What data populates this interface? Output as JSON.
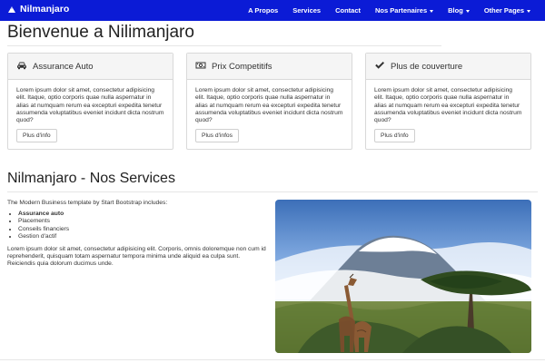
{
  "navbar": {
    "brand": "Nilmanjaro",
    "items": [
      {
        "label": "A Propos"
      },
      {
        "label": "Services"
      },
      {
        "label": "Contact"
      },
      {
        "label": "Nos Partenaires"
      },
      {
        "label": "Blog"
      },
      {
        "label": "Other Pages"
      }
    ]
  },
  "page": {
    "title": "Bienvenue a Nilimanjaro"
  },
  "panels": [
    {
      "title": "Assurance Auto",
      "icon": "car-icon",
      "text": "Lorem ipsum dolor sit amet, consectetur adipisicing elit. Itaque, optio corporis quae nulla aspernatur in alias at numquam rerum ea excepturi expedita tenetur assumenda voluptatibus eveniet incidunt dicta nostrum quod?",
      "button": "Plus d'info"
    },
    {
      "title": "Prix Competitifs",
      "icon": "money-icon",
      "text": "Lorem ipsum dolor sit amet, consectetur adipisicing elit. Itaque, optio corporis quae nulla aspernatur in alias at numquam rerum ea excepturi expedita tenetur assumenda voluptatibus eveniet incidunt dicta nostrum quod?",
      "button": "Plus d'infos"
    },
    {
      "title": "Plus de couverture",
      "icon": "check-icon",
      "text": "Lorem ipsum dolor sit amet, consectetur adipisicing elit. Itaque, optio corporis quae nulla aspernatur in alias at numquam rerum ea excepturi expedita tenetur assumenda voluptatibus eveniet incidunt dicta nostrum quod?",
      "button": "Plus d'info"
    }
  ],
  "services": {
    "title": "Nilmanjaro - Nos Services",
    "intro": "The Modern Business template by Start Bootstrap includes:",
    "list": [
      {
        "text": "Assurance auto",
        "bold": true
      },
      {
        "text": "Placements",
        "bold": false
      },
      {
        "text": "Conseils financiers",
        "bold": false
      },
      {
        "text": "Gestion d'actif",
        "bold": false
      }
    ],
    "paragraph": "Lorem ipsum dolor sit amet, consectetur adipisicing elit. Corporis, omnis doloremque non cum id reprehenderit, quisquam totam aspernatur tempora minima unde aliquid ea culpa sunt. Reiciendis quia dolorum ducimus unde."
  },
  "colors": {
    "navbar": "#0b1bd6",
    "panel_header": "#f5f5f5",
    "border": "#d9d9d9"
  }
}
